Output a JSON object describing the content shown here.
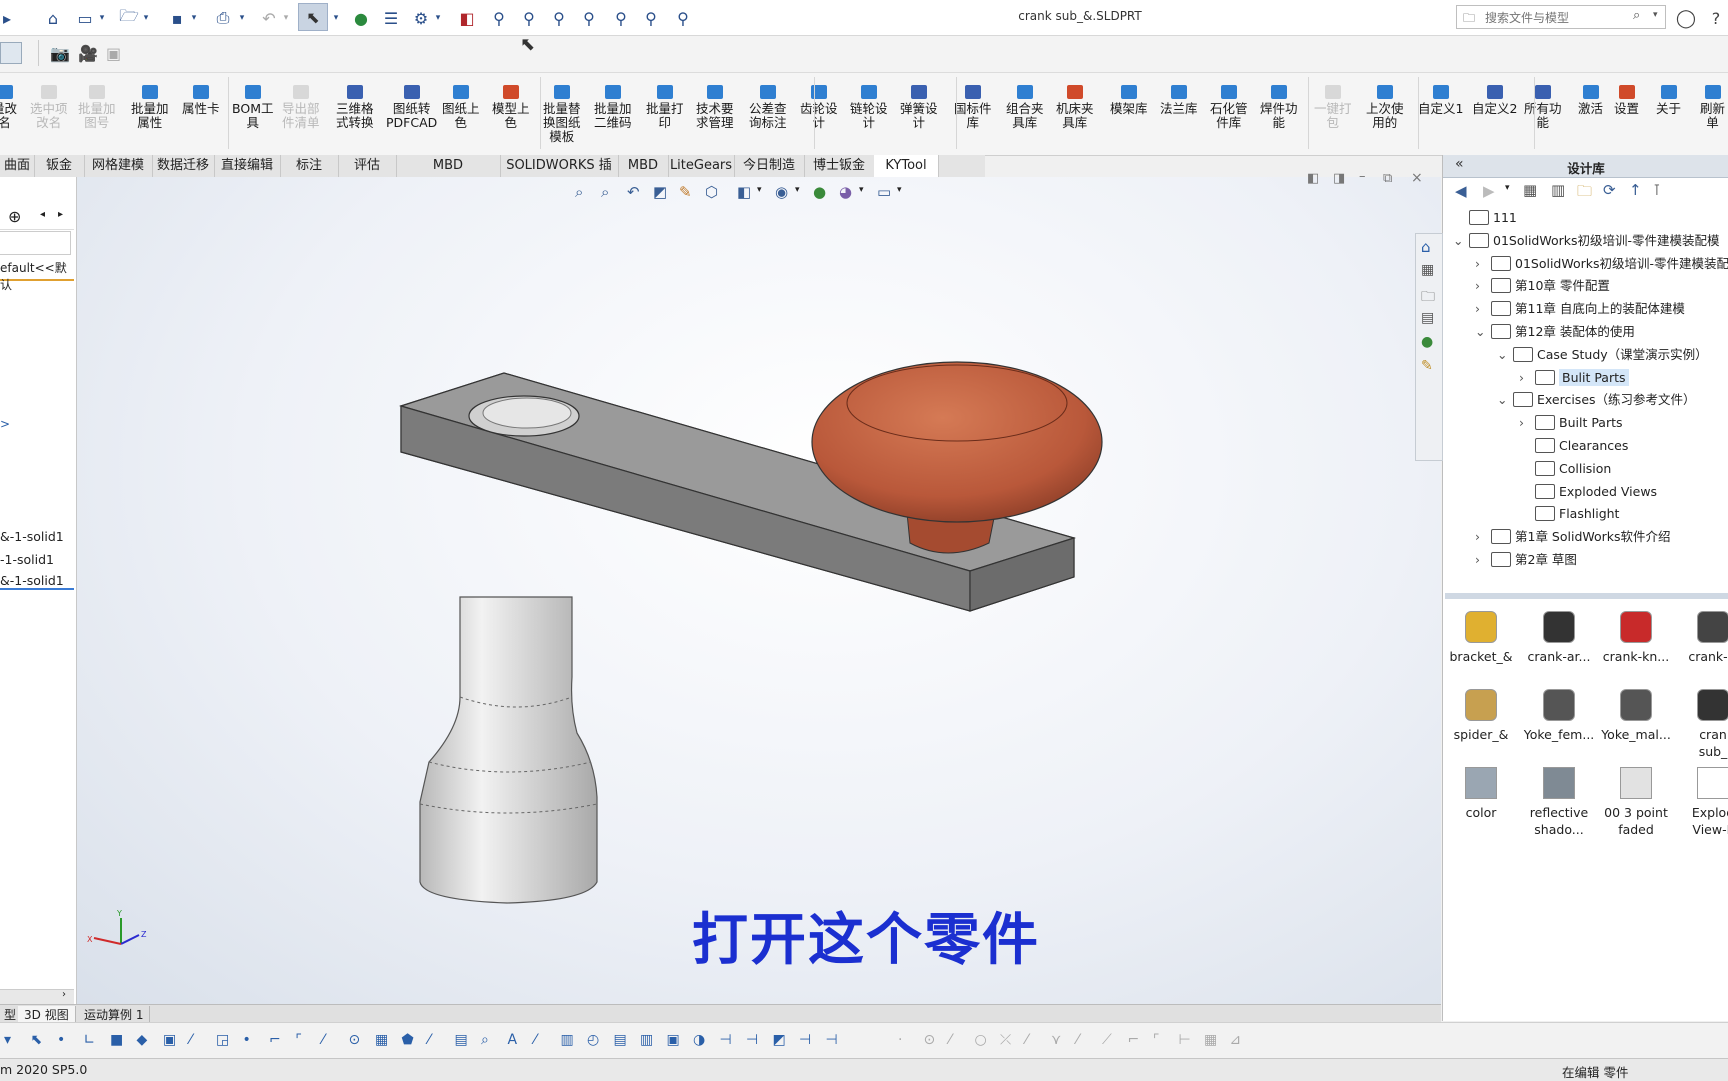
{
  "title_bar": {
    "document_title": "crank sub_&.SLDPRT",
    "search_placeholder": "搜索文件与模型"
  },
  "command_manager": {
    "buttons": [
      {
        "label": "量改\n名",
        "enabled": true
      },
      {
        "label": "选中项\n改名",
        "enabled": false
      },
      {
        "label": "批量加\n图号",
        "enabled": false
      },
      {
        "label": "批量加\n属性",
        "enabled": true
      },
      {
        "label": "属性卡",
        "enabled": true
      },
      {
        "label": "BOM工\n具",
        "enabled": true
      },
      {
        "label": "导出部\n件清单",
        "enabled": false
      },
      {
        "label": "三维格\n式转换",
        "enabled": true
      },
      {
        "label": "图纸转\nPDFCAD",
        "enabled": true
      },
      {
        "label": "图纸上\n色",
        "enabled": true
      },
      {
        "label": "模型上\n色",
        "enabled": true
      },
      {
        "label": "批量替\n换图纸\n模板",
        "enabled": true
      },
      {
        "label": "批量加\n二维码",
        "enabled": true
      },
      {
        "label": "批量打\n印",
        "enabled": true
      },
      {
        "label": "技术要\n求管理",
        "enabled": true
      },
      {
        "label": "公差查\n询标注",
        "enabled": true
      },
      {
        "label": "齿轮设\n计",
        "enabled": true
      },
      {
        "label": "链轮设\n计",
        "enabled": true
      },
      {
        "label": "弹簧设\n计",
        "enabled": true
      },
      {
        "label": "国标件\n库",
        "enabled": true
      },
      {
        "label": "组合夹\n具库",
        "enabled": true
      },
      {
        "label": "机床夹\n具库",
        "enabled": true
      },
      {
        "label": "模架库",
        "enabled": true
      },
      {
        "label": "法兰库",
        "enabled": true
      },
      {
        "label": "石化管\n件库",
        "enabled": true
      },
      {
        "label": "焊件功\n能",
        "enabled": true
      },
      {
        "label": "一键打\n包",
        "enabled": false
      },
      {
        "label": "上次使\n用的",
        "enabled": true
      },
      {
        "label": "自定义1",
        "enabled": true
      },
      {
        "label": "自定义2",
        "enabled": true
      },
      {
        "label": "所有功\n能",
        "enabled": true
      },
      {
        "label": "激活",
        "enabled": true
      },
      {
        "label": "设置",
        "enabled": true
      },
      {
        "label": "关于",
        "enabled": true
      },
      {
        "label": "刷新\n单",
        "enabled": true
      }
    ]
  },
  "tabs": [
    "曲面",
    "钣金",
    "网格建模",
    "数据迁移",
    "直接编辑",
    "标注",
    "评估",
    "MBD Dimensions",
    "SOLIDWORKS 插件",
    "MBD",
    "LiteGears",
    "今日制造",
    "博士钣金",
    "KYTool"
  ],
  "active_tab": "KYTool",
  "left_panel": {
    "config_text": "efault<<默认",
    "arrow": ">",
    "bodies": [
      "&-1-solid1",
      "-1-solid1",
      "&-1-solid1"
    ]
  },
  "viewport": {
    "caption": "打开这个零件",
    "triad": {
      "x": "X",
      "y": "Y",
      "z": "Z"
    }
  },
  "task_pane": {
    "title": "设计库",
    "tree": [
      {
        "label": "111",
        "level": 0,
        "expander": ""
      },
      {
        "label": "01SolidWorks初级培训-零件建模装配模",
        "level": 0,
        "expander": "⌄"
      },
      {
        "label": "01SolidWorks初级培训-零件建模装配",
        "level": 1,
        "expander": "›"
      },
      {
        "label": "第10章 零件配置",
        "level": 1,
        "expander": "›"
      },
      {
        "label": "第11章 自底向上的装配体建模",
        "level": 1,
        "expander": "›"
      },
      {
        "label": "第12章 装配体的使用",
        "level": 1,
        "expander": "⌄"
      },
      {
        "label": "Case Study（课堂演示实例）",
        "level": 2,
        "expander": "⌄"
      },
      {
        "label": "Bulit Parts",
        "level": 3,
        "expander": "›",
        "selected": true
      },
      {
        "label": "Exercises（练习参考文件）",
        "level": 2,
        "expander": "⌄"
      },
      {
        "label": "Built Parts",
        "level": 3,
        "expander": "›"
      },
      {
        "label": "Clearances",
        "level": 3,
        "expander": ""
      },
      {
        "label": "Collision",
        "level": 3,
        "expander": ""
      },
      {
        "label": "Exploded Views",
        "level": 3,
        "expander": ""
      },
      {
        "label": "Flashlight",
        "level": 3,
        "expander": ""
      },
      {
        "label": "第1章 SolidWorks软件介绍",
        "level": 1,
        "expander": "›"
      },
      {
        "label": "第2章 草图",
        "level": 1,
        "expander": "›"
      }
    ],
    "library_items": [
      {
        "label": "bracket_&",
        "icon": "bracket-part-icon"
      },
      {
        "label": "crank-ar...",
        "icon": "crank-arm-part-icon"
      },
      {
        "label": "crank-kn...",
        "icon": "crank-knob-part-icon"
      },
      {
        "label": "crank-sl",
        "icon": "crank-shaft-part-icon"
      },
      {
        "label": "spider_&",
        "icon": "spider-part-icon"
      },
      {
        "label": "Yoke_fem...",
        "icon": "yoke-female-part-icon"
      },
      {
        "label": "Yoke_mal...",
        "icon": "yoke-male-part-icon"
      },
      {
        "label": "cran\nsub_",
        "icon": "crank-sub-part-icon"
      },
      {
        "label": "color",
        "icon": "color-scene-icon"
      },
      {
        "label": "reflective\nshado...",
        "icon": "reflective-shadow-scene-icon"
      },
      {
        "label": "00 3 point\nfaded",
        "icon": "three-point-faded-scene-icon"
      },
      {
        "label": "Explod\nView-L",
        "icon": "exploded-view-folder-icon"
      }
    ]
  },
  "bottom_tabs": [
    "型",
    "3D 视图",
    "运动算例 1"
  ],
  "status_bar": {
    "left": "m 2020 SP5.0",
    "right": "在编辑 零件"
  },
  "colors": {
    "caption": "#1b2fd0",
    "knob": "#c0603d",
    "arm": "#8a8a8a",
    "shaft": "#d4d4d4",
    "selection": "#d4e6f8"
  }
}
